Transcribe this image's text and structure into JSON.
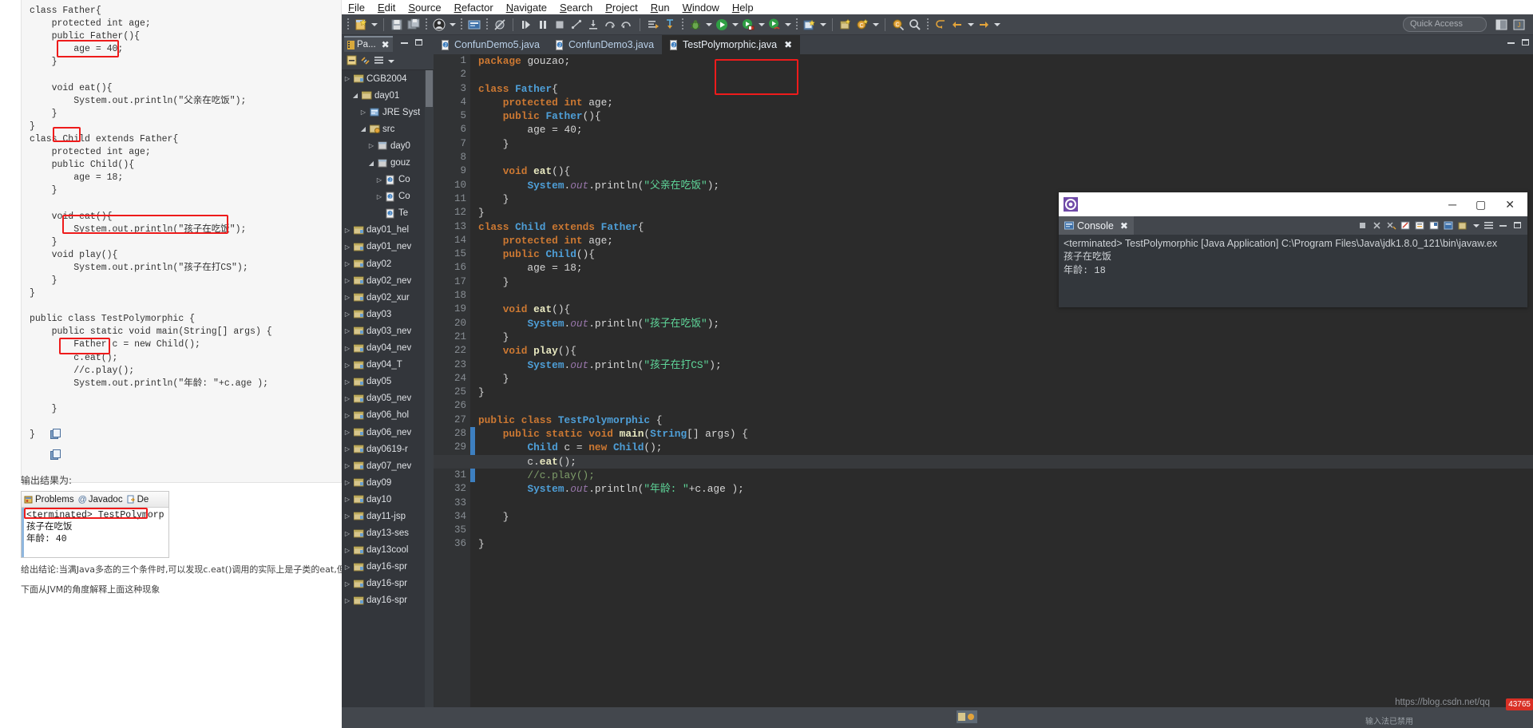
{
  "blog": {
    "code_lines": [
      "class Father{",
      "    protected int age;",
      "    public Father(){",
      "        age = 40;",
      "    }",
      "",
      "    void eat(){",
      "        System.out.println(\"父亲在吃饭\");",
      "    }",
      "}",
      "class Child extends Father{",
      "    protected int age;",
      "    public Child(){",
      "        age = 18;",
      "    }",
      "",
      "    void eat(){",
      "        System.out.println(\"孩子在吃饭\");",
      "    }",
      "    void play(){",
      "        System.out.println(\"孩子在打CS\");",
      "    }",
      "}",
      "",
      "public class TestPolymorphic {",
      "    public static void main(String[] args) {",
      "        Father c = new Child();",
      "        c.eat();",
      "        //c.play();",
      "        System.out.println(\"年龄: \"+c.age );",
      "",
      "    }",
      "",
      "}"
    ],
    "output_label": "输出结果为:",
    "conclusion": "给出结论:当满Java多态的三个条件时,可以发现c.eat()调用的实际上是子类的eat,但c.a",
    "note": "下面从JVM的角度解释上面这种现象",
    "mini_console": {
      "tabs": [
        "Problems",
        "Javadoc",
        "De"
      ],
      "terminated": "<terminated> TestPolymorp",
      "lines": [
        "孩子在吃饭",
        "年龄: 40"
      ]
    }
  },
  "eclipse": {
    "menu": [
      "File",
      "Edit",
      "Source",
      "Refactor",
      "Navigate",
      "Search",
      "Project",
      "Run",
      "Window",
      "Help"
    ],
    "quick_access": "Quick Access",
    "package_explorer": {
      "tab_label": "Pa...",
      "tree": [
        {
          "indent": 0,
          "arrow": "collapsed",
          "icon": "project",
          "label": "CGB2004"
        },
        {
          "indent": 1,
          "arrow": "expanded",
          "icon": "package",
          "label": "day01"
        },
        {
          "indent": 2,
          "arrow": "collapsed",
          "icon": "library",
          "label": "JRE Syst"
        },
        {
          "indent": 2,
          "arrow": "expanded",
          "icon": "source",
          "label": "src"
        },
        {
          "indent": 3,
          "arrow": "collapsed",
          "icon": "pkg",
          "label": "day0"
        },
        {
          "indent": 3,
          "arrow": "expanded",
          "icon": "pkg",
          "label": "gouz"
        },
        {
          "indent": 4,
          "arrow": "collapsed",
          "icon": "java",
          "label": "Co"
        },
        {
          "indent": 4,
          "arrow": "collapsed",
          "icon": "java",
          "label": "Co"
        },
        {
          "indent": 4,
          "arrow": "none",
          "icon": "java",
          "label": "Te"
        },
        {
          "indent": 0,
          "arrow": "collapsed",
          "icon": "project",
          "label": "day01_hel"
        },
        {
          "indent": 0,
          "arrow": "collapsed",
          "icon": "project",
          "label": "day01_nev"
        },
        {
          "indent": 0,
          "arrow": "collapsed",
          "icon": "project",
          "label": "day02"
        },
        {
          "indent": 0,
          "arrow": "collapsed",
          "icon": "project",
          "label": "day02_nev"
        },
        {
          "indent": 0,
          "arrow": "collapsed",
          "icon": "project",
          "label": "day02_xur"
        },
        {
          "indent": 0,
          "arrow": "collapsed",
          "icon": "project",
          "label": "day03"
        },
        {
          "indent": 0,
          "arrow": "collapsed",
          "icon": "project",
          "label": "day03_nev"
        },
        {
          "indent": 0,
          "arrow": "collapsed",
          "icon": "project",
          "label": "day04_nev"
        },
        {
          "indent": 0,
          "arrow": "collapsed",
          "icon": "project",
          "label": "day04_T"
        },
        {
          "indent": 0,
          "arrow": "collapsed",
          "icon": "project",
          "label": "day05"
        },
        {
          "indent": 0,
          "arrow": "collapsed",
          "icon": "project",
          "label": "day05_nev"
        },
        {
          "indent": 0,
          "arrow": "collapsed",
          "icon": "project",
          "label": "day06_hol"
        },
        {
          "indent": 0,
          "arrow": "collapsed",
          "icon": "project",
          "label": "day06_nev"
        },
        {
          "indent": 0,
          "arrow": "collapsed",
          "icon": "project",
          "label": "day0619-r"
        },
        {
          "indent": 0,
          "arrow": "collapsed",
          "icon": "project",
          "label": "day07_nev"
        },
        {
          "indent": 0,
          "arrow": "collapsed",
          "icon": "project",
          "label": "day09"
        },
        {
          "indent": 0,
          "arrow": "collapsed",
          "icon": "project",
          "label": "day10"
        },
        {
          "indent": 0,
          "arrow": "collapsed",
          "icon": "project",
          "label": "day11-jsp"
        },
        {
          "indent": 0,
          "arrow": "collapsed",
          "icon": "project",
          "label": "day13-ses"
        },
        {
          "indent": 0,
          "arrow": "collapsed",
          "icon": "project",
          "label": "day13cool"
        },
        {
          "indent": 0,
          "arrow": "collapsed",
          "icon": "project",
          "label": "day16-spr"
        },
        {
          "indent": 0,
          "arrow": "collapsed",
          "icon": "project",
          "label": "day16-spr"
        },
        {
          "indent": 0,
          "arrow": "collapsed",
          "icon": "project",
          "label": "day16-spr"
        }
      ]
    },
    "editor_tabs": [
      {
        "label": "ConfunDemo5.java",
        "active": false,
        "closable": false
      },
      {
        "label": "ConfunDemo3.java",
        "active": false,
        "closable": false
      },
      {
        "label": "TestPolymorphic.java",
        "active": true,
        "closable": true
      }
    ],
    "code": {
      "first_line": 1,
      "total_lines": 36,
      "highlight_line": 30,
      "markers": {
        "5": "override",
        "9": "override",
        "15": "override",
        "19": "warning-override",
        "22": "override",
        "28": "run"
      },
      "lines": [
        "package gouzao;",
        "",
        "class Father{",
        "    protected int age;",
        "    public Father(){",
        "        age = 40;",
        "    }",
        "",
        "    void eat(){",
        "        System.out.println(\"父亲在吃饭\");",
        "    }",
        "}",
        "class Child extends Father{",
        "    protected int age;",
        "    public Child(){",
        "        age = 18;",
        "    }",
        "",
        "    void eat(){",
        "        System.out.println(\"孩子在吃饭\");",
        "    }",
        "    void play(){",
        "        System.out.println(\"孩子在打CS\");",
        "    }",
        "}",
        "",
        "public class TestPolymorphic {",
        "    public static void main(String[] args) {",
        "        Child c = new Child();",
        "        c.eat();",
        "        //c.play();",
        "        System.out.println(\"年龄: \"+c.age );",
        "",
        "    }",
        "",
        "}"
      ]
    },
    "console_window": {
      "tab_label": "Console",
      "terminated_line": "<terminated> TestPolymorphic [Java Application] C:\\Program Files\\Java\\jdk1.8.0_121\\bin\\javaw.ex",
      "output": [
        "孩子在吃饭",
        "年龄: 18"
      ]
    },
    "watermark": "https://blog.csdn.net/qq",
    "watermark_badge": "43765",
    "cn_status": "输入法已禁用"
  },
  "colors": {
    "highlight_red": "#ee1b1b",
    "editor_bg": "#2b2b2b",
    "keyword": "#cc7832",
    "type": "#4e9fd8",
    "string": "#5fd79a",
    "field": "#9876aa",
    "comment": "#7f9e6a"
  }
}
